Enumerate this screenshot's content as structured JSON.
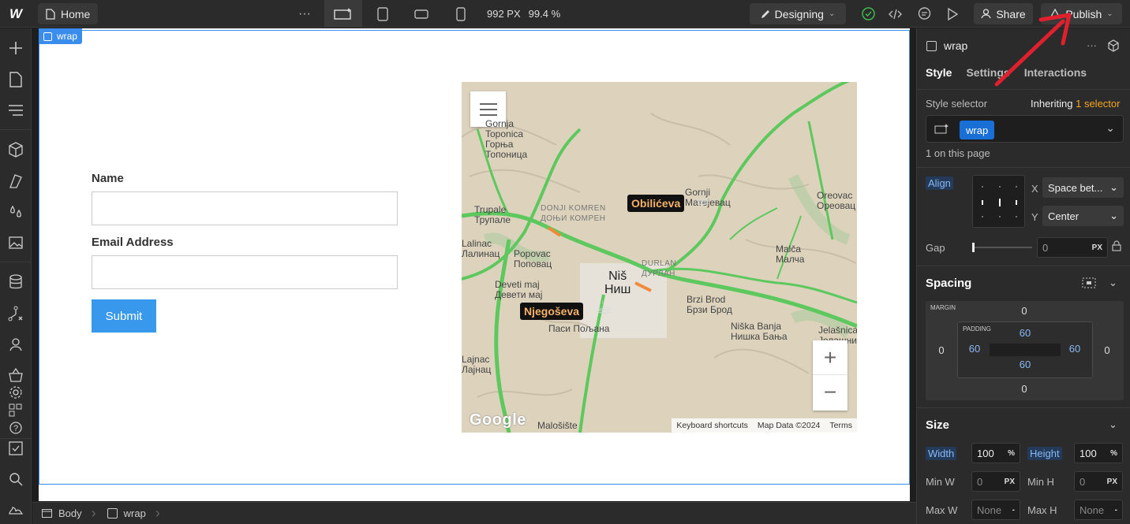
{
  "topbar": {
    "logo": "W",
    "page_name": "Home",
    "more": "···",
    "viewport_width": "992 PX",
    "viewport_zoom": "99.4 %",
    "mode": "Designing",
    "share": "Share",
    "publish": "Publish"
  },
  "canvas": {
    "wrap_tag": "wrap",
    "form": {
      "name_label": "Name",
      "name_value": "",
      "email_label": "Email Address",
      "email_value": "",
      "submit": "Submit"
    },
    "map": {
      "labels": {
        "gornja": "Gornja",
        "toponica": "Toponica",
        "toponica_cyr": "Горња\nТопоница",
        "donji_komren": "DONJI KOMREN\nДОЊИ КОМРЕН",
        "trupale": "Trupale\nТрупале",
        "lalinac": "Lalinac\nЛалинац",
        "popovac": "Popovac\nПоповац",
        "devetimaj": "Deveti maj\nДевети мај",
        "nis": "Niš\nНиш",
        "durlan": "DURLAN\nДУРЛАН",
        "brzi_brod": "Brzi Brod\nБрзи Брод",
        "niska_banja": "Niška Banja\nНишка Бања",
        "jelasnica": "Jelašnica\nЈелашница",
        "oreovac": "Oreovac\nОреовац",
        "malca": "Malča\nМалча",
        "matejevac": "Gornji\nМатејевац",
        "pasi": "Паси Пољана",
        "lajnac": "Lajnac\nЛајнац",
        "malosiste": "Malošište"
      },
      "marker_obilicevo": "Obilićeva",
      "marker_njegoseva": "Njegoševa",
      "google": "Google",
      "attribution": [
        "Keyboard shortcuts",
        "Map Data ©2024",
        "Terms"
      ],
      "zoom_in": "+",
      "zoom_out": "−"
    }
  },
  "breadcrumb": {
    "items": [
      "Body",
      "wrap"
    ]
  },
  "panel": {
    "element": "wrap",
    "tabs": [
      "Style",
      "Settings",
      "Interactions"
    ],
    "style_selector_label": "Style selector",
    "inheriting_prefix": "Inheriting",
    "inheriting_link": "1 selector",
    "selector_chip": "wrap",
    "on_page": "1 on this page",
    "align_label": "Align",
    "x_label": "X",
    "x_value": "Space bet...",
    "y_label": "Y",
    "y_value": "Center",
    "gap_label": "Gap",
    "gap_value": "0",
    "gap_unit": "PX",
    "spacing_title": "Spacing",
    "margin_label": "MARGIN",
    "padding_label": "PADDING",
    "margin": {
      "top": "0",
      "right": "0",
      "bottom": "0",
      "left": "0"
    },
    "padding": {
      "top": "60",
      "right": "60",
      "bottom": "60",
      "left": "60"
    },
    "size_title": "Size",
    "width_label": "Width",
    "width_value": "100",
    "width_unit": "%",
    "height_label": "Height",
    "height_value": "100",
    "height_unit": "%",
    "minw_label": "Min W",
    "minw_value": "0",
    "minw_unit": "PX",
    "minh_label": "Min H",
    "minh_value": "0",
    "minh_unit": "PX",
    "maxw_label": "Max W",
    "maxw_value": "None",
    "maxw_unit": "-",
    "maxh_label": "Max H",
    "maxh_value": "None",
    "maxh_unit": "-"
  },
  "colors": {
    "accent_blue": "#3b8ded",
    "submit_blue": "#3898ec",
    "selection_chip": "#1a6fd6",
    "marker_text": "#f6b26b",
    "annotation_red": "#e0202c"
  }
}
